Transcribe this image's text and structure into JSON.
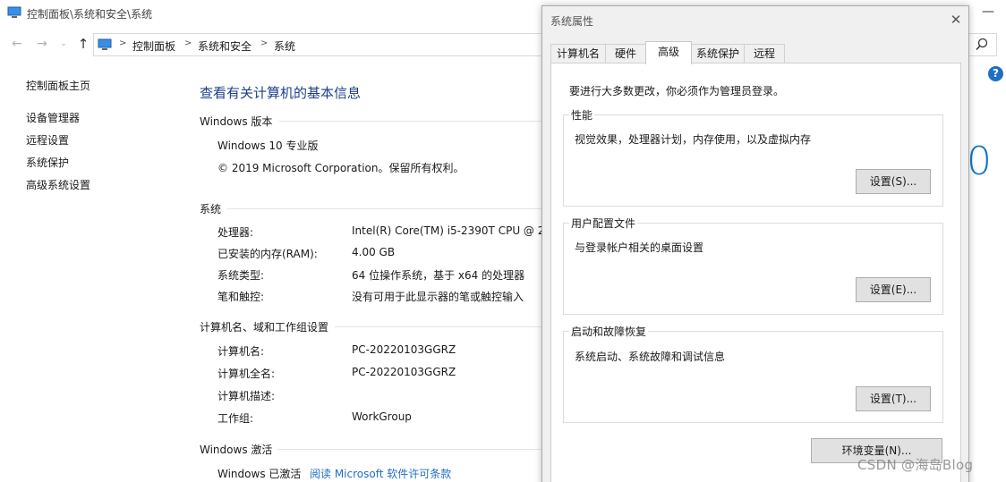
{
  "window": {
    "title": "控制面板\\系统和安全\\系统",
    "minimize_glyph": "—"
  },
  "address": {
    "crumbs": [
      "控制面板",
      "系统和安全",
      "系统"
    ]
  },
  "sidebar": {
    "items": [
      {
        "label": "控制面板主页"
      },
      {
        "label": "设备管理器"
      },
      {
        "label": "远程设置"
      },
      {
        "label": "系统保护"
      },
      {
        "label": "高级系统设置"
      }
    ]
  },
  "main": {
    "title": "查看有关计算机的基本信息",
    "edition": {
      "heading": "Windows 版本",
      "name": "Windows 10 专业版",
      "copyright": "© 2019 Microsoft Corporation。保留所有权利。"
    },
    "system": {
      "heading": "系统",
      "rows": [
        {
          "label": "处理器:",
          "value": "Intel(R) Core(TM) i5-2390T CPU @ 2."
        },
        {
          "label": "已安装的内存(RAM):",
          "value": "4.00 GB"
        },
        {
          "label": "系统类型:",
          "value": "64 位操作系统，基于 x64 的处理器"
        },
        {
          "label": "笔和触控:",
          "value": "没有可用于此显示器的笔或触控输入"
        }
      ]
    },
    "computer": {
      "heading": "计算机名、域和工作组设置",
      "rows": [
        {
          "label": "计算机名:",
          "value": "PC-20220103GGRZ"
        },
        {
          "label": "计算机全名:",
          "value": "PC-20220103GGRZ"
        },
        {
          "label": "计算机描述:",
          "value": ""
        },
        {
          "label": "工作组:",
          "value": "WorkGroup"
        }
      ]
    },
    "activation": {
      "heading": "Windows 激活",
      "status": "Windows 已激活",
      "license_link": "阅读 Microsoft 软件许可条款"
    },
    "brand_fragment": "0"
  },
  "dialog": {
    "title": "系统属性",
    "close_glyph": "✕",
    "tabs": [
      {
        "label": "计算机名",
        "active": false
      },
      {
        "label": "硬件",
        "active": false
      },
      {
        "label": "高级",
        "active": true
      },
      {
        "label": "系统保护",
        "active": false
      },
      {
        "label": "远程",
        "active": false
      }
    ],
    "admin_note": "要进行大多数更改，你必须作为管理员登录。",
    "groups": [
      {
        "title": "性能",
        "description": "视觉效果，处理器计划，内存使用，以及虚拟内存",
        "button": "设置(S)..."
      },
      {
        "title": "用户配置文件",
        "description": "与登录帐户相关的桌面设置",
        "button": "设置(E)..."
      },
      {
        "title": "启动和故障恢复",
        "description": "系统启动、系统故障和调试信息",
        "button": "设置(T)..."
      }
    ],
    "env_button": "环境变量(N)..."
  },
  "watermark": "CSDN @海岛Blog",
  "colors": {
    "link": "#1f6fc5",
    "title_blue": "#1e3f8a",
    "help": "#1f6fc5"
  }
}
